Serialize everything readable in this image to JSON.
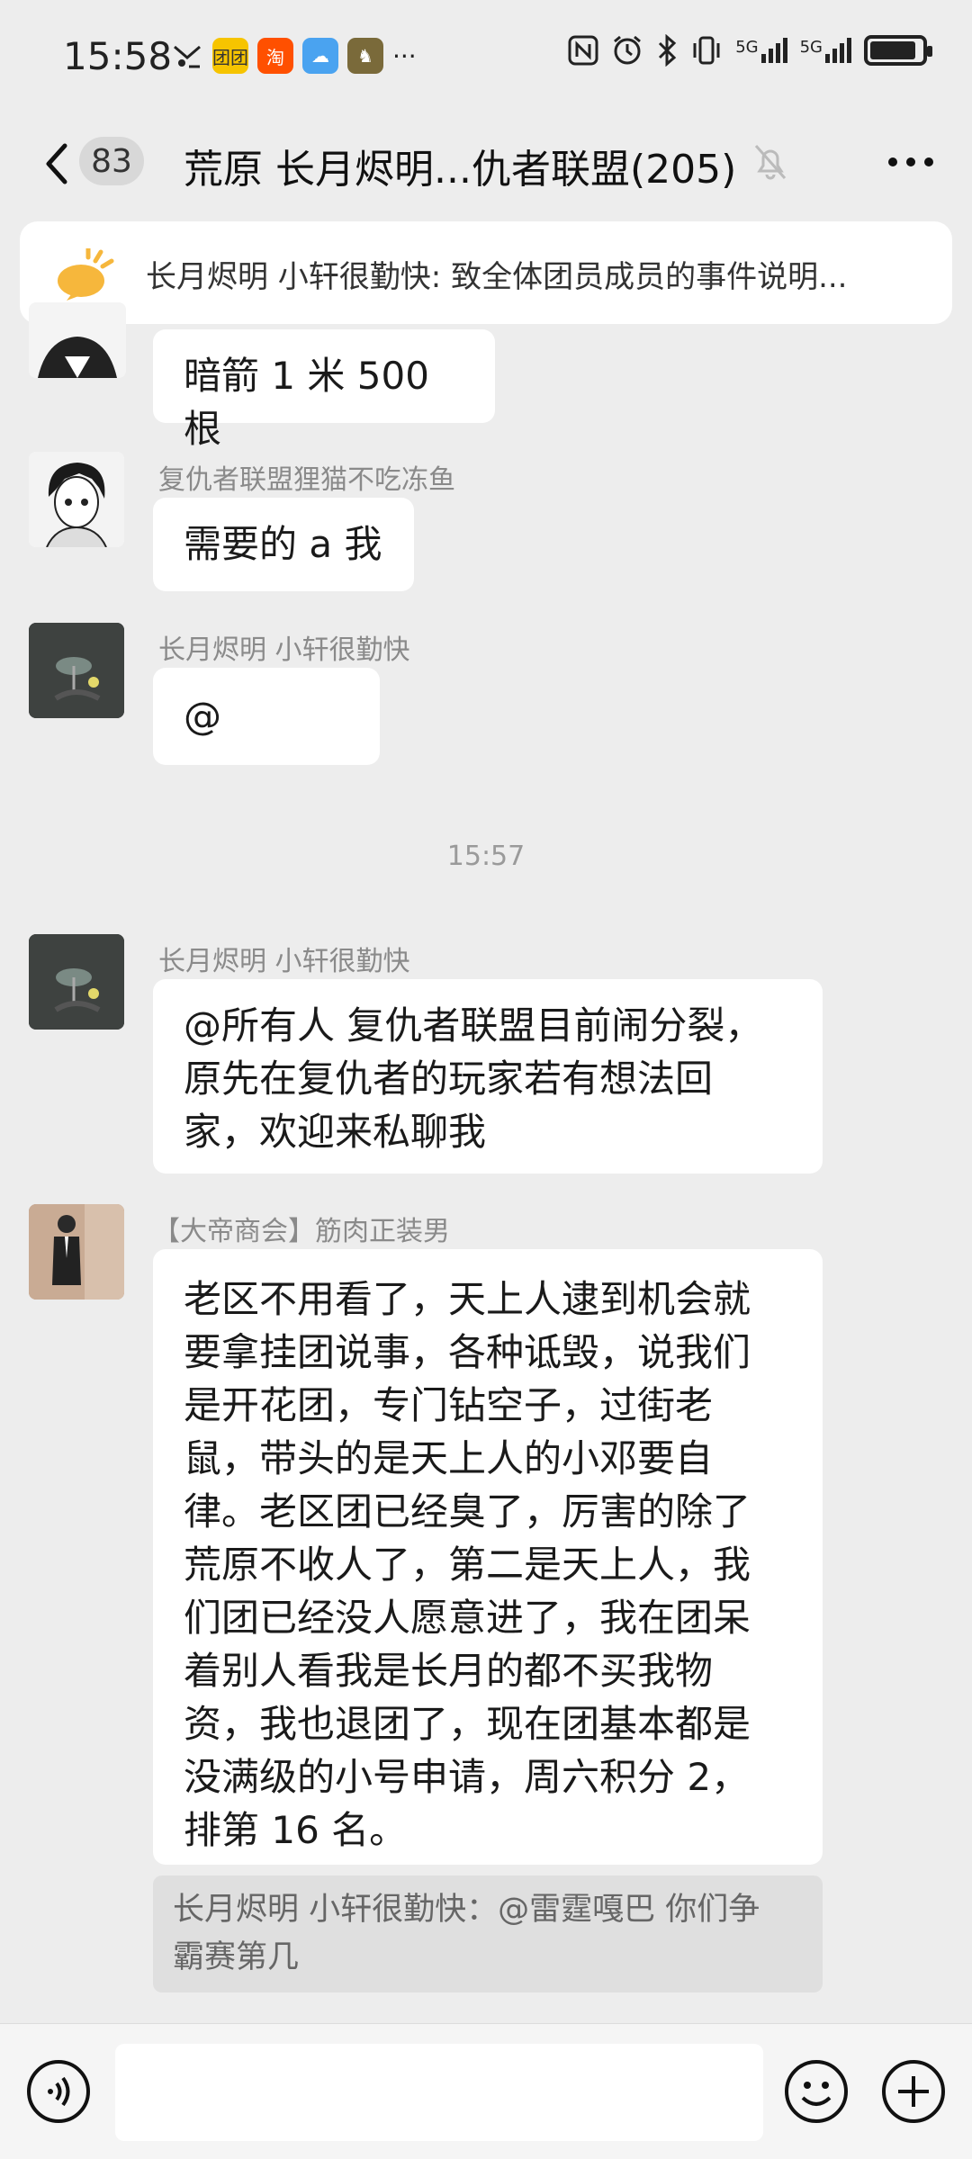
{
  "status_bar": {
    "time": "15:58",
    "apps": [
      {
        "icon": "notification-icon",
        "label": ""
      },
      {
        "icon": "app-icon-1",
        "label": "团团"
      },
      {
        "icon": "taobao-icon",
        "label": "淘"
      },
      {
        "icon": "weather-icon",
        "label": ""
      },
      {
        "icon": "game-icon",
        "label": ""
      }
    ],
    "more": "···",
    "signal_1": "5G",
    "signal_2": "5G"
  },
  "header": {
    "unread_count": "83",
    "title": "荒原  长月烬明...仇者联盟(205)"
  },
  "notice": {
    "text": "长月烬明 小轩很勤快: 致全体团员成员的事件说明..."
  },
  "messages": [
    {
      "sender": "",
      "text": "暗箭 1 米 500 根"
    },
    {
      "sender": "复仇者联盟狸猫不吃冻鱼",
      "text": "需要的 a 我"
    },
    {
      "sender": "长月烬明 小轩很勤快",
      "text": "@"
    },
    {
      "sender": "长月烬明 小轩很勤快",
      "lines": [
        "@所有人  复仇者联盟目前闹分裂，",
        "原先在复仇者的玩家若有想法回",
        "家，欢迎来私聊我"
      ]
    },
    {
      "sender": "【大帝商会】筋肉正装男",
      "lines": [
        "老区不用看了，天上人逮到机会就",
        "要拿挂团说事，各种诋毁，说我们",
        "是开花团，专门钻空子，过街老",
        "鼠，带头的是天上人的小邓要自",
        "律。老区团已经臭了，厉害的除了",
        "荒原不收人了，第二是天上人，我",
        "们团已经没人愿意进了，我在团呆",
        "着别人看我是长月的都不买我物",
        "资，我也退团了，现在团基本都是",
        "没满级的小号申请，周六积分 2，",
        "排第 16 名。"
      ]
    }
  ],
  "timestamp": "15:57",
  "quote": {
    "lines": [
      "长月烬明 小轩很勤快：@雷霆嘎巴 你们争",
      "霸赛第几"
    ]
  },
  "input": {
    "placeholder": ""
  },
  "colors": {
    "background": "#ededed",
    "bubble": "#ffffff",
    "quote_bg": "#dfdfdf"
  },
  "battery_level": 0.9
}
